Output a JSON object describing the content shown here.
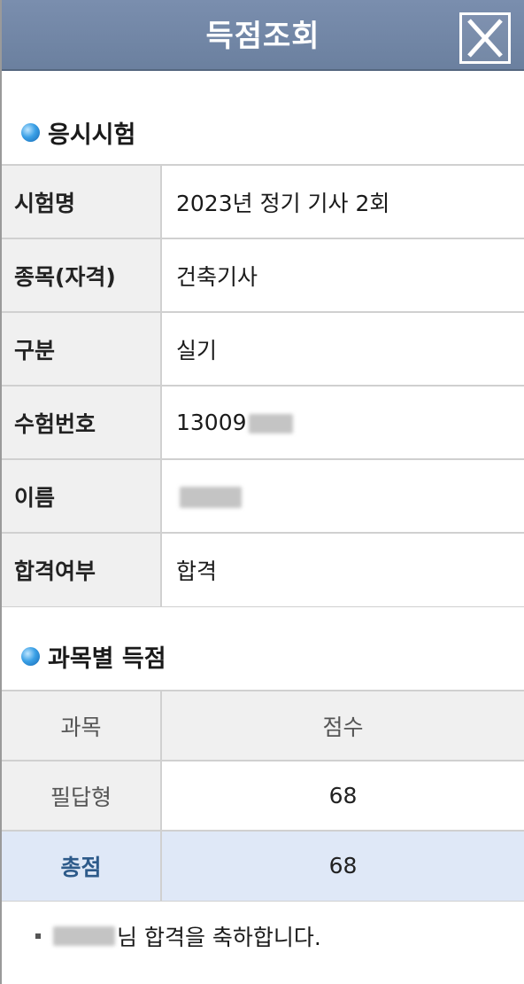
{
  "titlebar": {
    "title": "득점조회",
    "close_icon": "close-icon"
  },
  "exam_section": {
    "heading": "응시시험",
    "rows": [
      {
        "label": "시험명",
        "value": "2023년 정기 기사 2회"
      },
      {
        "label": "종목(자격)",
        "value": "건축기사"
      },
      {
        "label": "구분",
        "value": "실기"
      },
      {
        "label": "수험번호",
        "value": "13009"
      },
      {
        "label": "이름",
        "value": ""
      },
      {
        "label": "합격여부",
        "value": "합격"
      }
    ]
  },
  "score_section": {
    "heading": "과목별 득점",
    "headers": [
      "과목",
      "점수"
    ],
    "rows": [
      {
        "subject": "필답형",
        "score": "68"
      }
    ],
    "total": {
      "label": "총점",
      "score": "68"
    }
  },
  "message": {
    "suffix": "님 합격을 축하합니다."
  },
  "colors": {
    "titlebar": "#7a8eae",
    "accent_bullet": "#3aa0e6",
    "total_row": "#dfe8f7",
    "total_label": "#2d5a8a"
  }
}
